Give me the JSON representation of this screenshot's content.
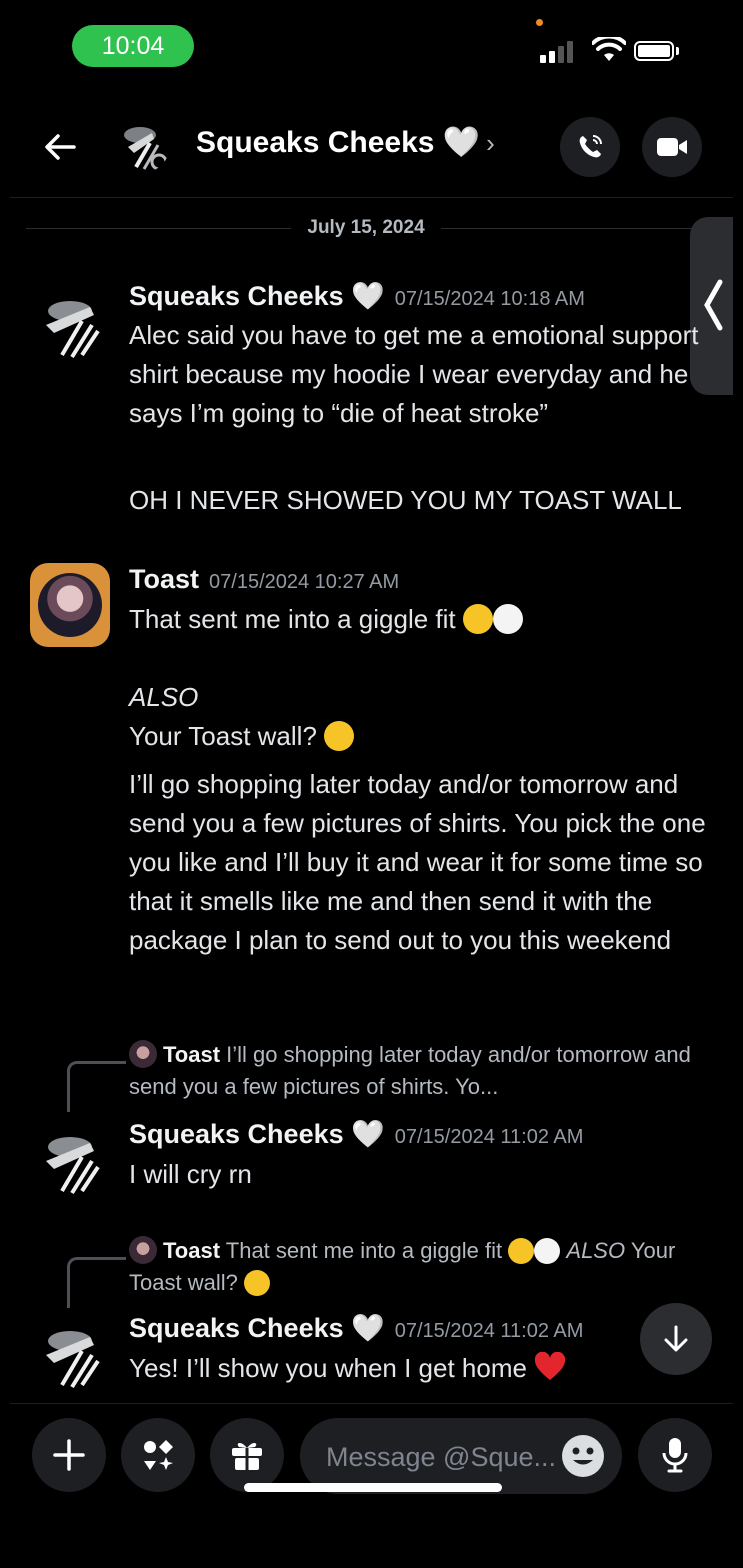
{
  "status_bar": {
    "time": "10:04"
  },
  "header": {
    "title": "Squeaks Cheeks 🤍",
    "chevron": "›"
  },
  "date_divider": "July 15, 2024",
  "messages": [
    {
      "author": "Squeaks Cheeks 🤍",
      "timestamp": "07/15/2024 10:18 AM",
      "paragraphs": [
        "Alec said you have to get me a emotional support shirt because my hoodie I wear everyday and he says I’m going to “die of heat stroke”",
        "OH I NEVER SHOWED YOU MY TOAST WALL"
      ]
    },
    {
      "author": "Toast",
      "timestamp": "07/15/2024 10:27 AM",
      "line1": "That sent me into a giggle fit",
      "line2": "ALSO",
      "line3": "Your Toast wall?",
      "paragraph": "I’ll go shopping later today and/or tomorrow and send you a few pictures of shirts. You pick the one you like and I’ll buy it and wear it for some time so that it smells like me and then send it with the package I plan to send out to you this weekend"
    },
    {
      "reply_to": {
        "author": "Toast",
        "text": "I’ll go shopping later today and/or tomorrow and send you a few pictures of shirts. Yo..."
      },
      "author": "Squeaks Cheeks 🤍",
      "timestamp": "07/15/2024 11:02 AM",
      "text": "I will cry rn"
    },
    {
      "reply_to": {
        "author": "Toast",
        "text": "That sent me into a giggle fit",
        "text_italic": "ALSO",
        "text2": "Your Toast wall?"
      },
      "author": "Squeaks Cheeks 🤍",
      "timestamp": "07/15/2024 11:02 AM",
      "text": "Yes! I’ll show you when I get home"
    }
  ],
  "composer": {
    "placeholder": "Message @Sque..."
  },
  "icons": {
    "back": "arrow-left-icon",
    "call": "phone-icon",
    "video": "video-camera-icon",
    "add": "plus-icon",
    "apps": "apps-icon",
    "gift": "gift-icon",
    "emoji": "emoji-icon",
    "mic": "microphone-icon",
    "scroll": "arrow-down-icon"
  },
  "colors": {
    "background": "#000000",
    "status_pill": "#2fc24f",
    "muted": "#949ba4",
    "surface": "#1e1f22"
  }
}
